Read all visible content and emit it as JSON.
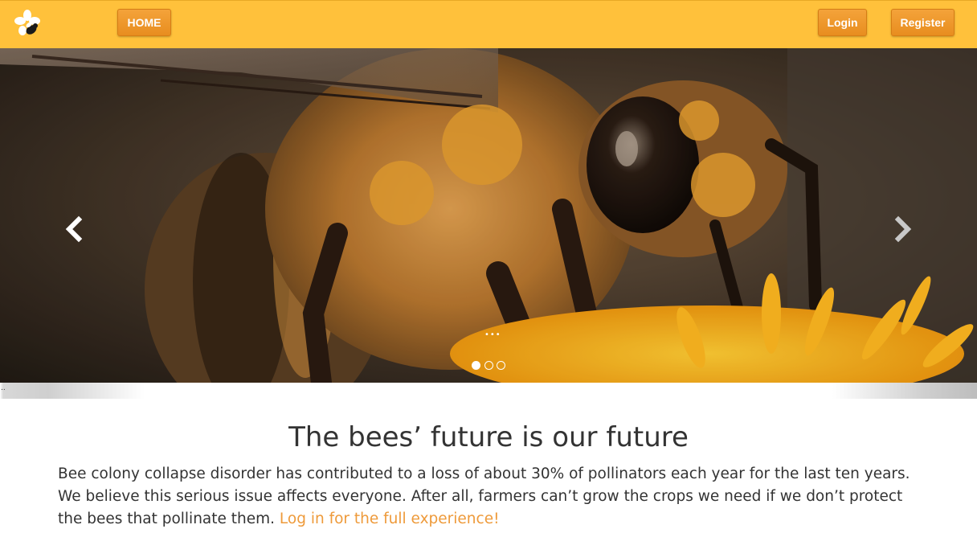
{
  "nav": {
    "logo_icon": "bee-flower-logo-icon",
    "home_label": "HOME",
    "login_label": "Login",
    "register_label": "Register"
  },
  "carousel": {
    "image_description_icon": "bee-on-flower-photo",
    "prev_icon": "chevron-left-icon",
    "next_icon": "chevron-right-icon",
    "caption": "•••",
    "slide_count": 3,
    "active_slide": 1
  },
  "shadow_mark": "..",
  "main": {
    "heading": "The bees’ future is our future",
    "intro_text": "Bee colony collapse disorder has contributed to a loss of about 30% of pollinators each year for the last ten years. We believe this serious issue affects everyone. After all, farmers can’t grow the crops we need if we don’t protect the bees that pollinate them. ",
    "cta_link": "Log in for the full experience!"
  },
  "colors": {
    "navbar": "#ffc13b",
    "button": "#ec9428",
    "link": "#ee9a3a",
    "text": "#333333"
  }
}
